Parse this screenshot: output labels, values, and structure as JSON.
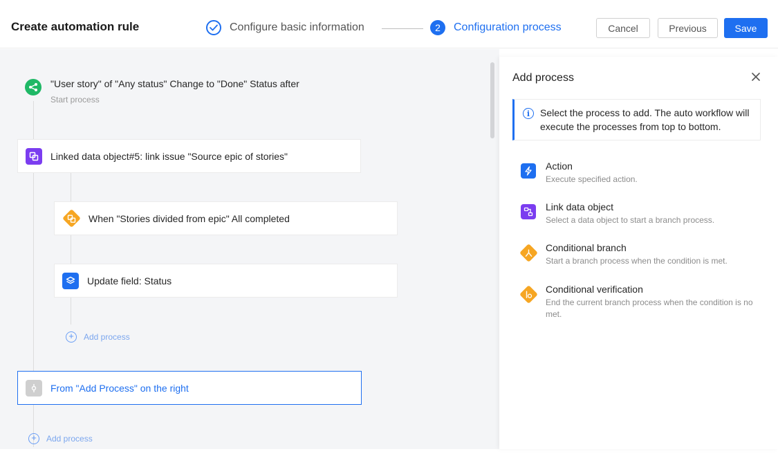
{
  "header": {
    "title": "Create automation rule",
    "step1_label": "Configure basic information",
    "step2_number": "2",
    "step2_label": "Configuration process",
    "cancel_label": "Cancel",
    "previous_label": "Previous",
    "save_label": "Save"
  },
  "flow": {
    "start": {
      "title": "\"User story\" of \"Any status\" Change to \"Done\" Status after",
      "subtitle": "Start process"
    },
    "linked_node": "Linked data object#5: link issue \"Source epic of stories\"",
    "when_node": "When \"Stories divided from epic\" All completed",
    "update_node": "Update field: Status",
    "inner_add": "Add process",
    "placeholder_node": "From \"Add Process\" on the right",
    "outer_add": "Add process"
  },
  "panel": {
    "title": "Add process",
    "info": "Select the process to add. The auto workflow will execute the processes from top to bottom.",
    "options": [
      {
        "name": "Action",
        "desc": "Execute specified action."
      },
      {
        "name": "Link data object",
        "desc": "Select a data object to start a branch process."
      },
      {
        "name": "Conditional branch",
        "desc": "Start a branch process when the condition is met."
      },
      {
        "name": "Conditional verification",
        "desc": "End the current branch process when the condition is no met."
      }
    ]
  },
  "colors": {
    "primary": "#1e6ff0",
    "green": "#1fb866",
    "purple": "#7b3df0",
    "orange": "#f6a623",
    "blue_icon": "#1e6ff0"
  }
}
